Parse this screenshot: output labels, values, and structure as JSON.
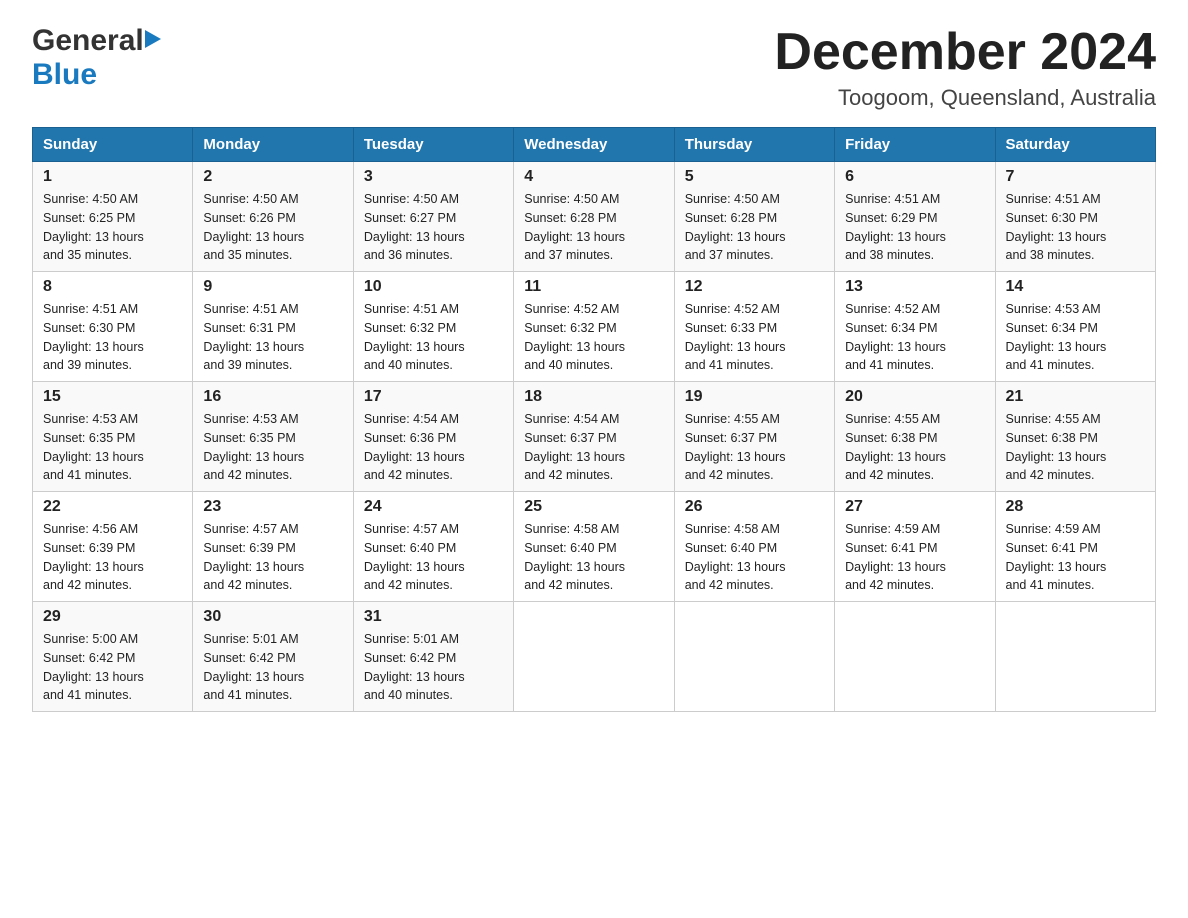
{
  "logo": {
    "general": "General",
    "blue": "Blue"
  },
  "header": {
    "title": "December 2024",
    "subtitle": "Toogoom, Queensland, Australia"
  },
  "days_of_week": [
    "Sunday",
    "Monday",
    "Tuesday",
    "Wednesday",
    "Thursday",
    "Friday",
    "Saturday"
  ],
  "weeks": [
    [
      {
        "day": "1",
        "sunrise": "4:50 AM",
        "sunset": "6:25 PM",
        "daylight": "13 hours and 35 minutes."
      },
      {
        "day": "2",
        "sunrise": "4:50 AM",
        "sunset": "6:26 PM",
        "daylight": "13 hours and 35 minutes."
      },
      {
        "day": "3",
        "sunrise": "4:50 AM",
        "sunset": "6:27 PM",
        "daylight": "13 hours and 36 minutes."
      },
      {
        "day": "4",
        "sunrise": "4:50 AM",
        "sunset": "6:28 PM",
        "daylight": "13 hours and 37 minutes."
      },
      {
        "day": "5",
        "sunrise": "4:50 AM",
        "sunset": "6:28 PM",
        "daylight": "13 hours and 37 minutes."
      },
      {
        "day": "6",
        "sunrise": "4:51 AM",
        "sunset": "6:29 PM",
        "daylight": "13 hours and 38 minutes."
      },
      {
        "day": "7",
        "sunrise": "4:51 AM",
        "sunset": "6:30 PM",
        "daylight": "13 hours and 38 minutes."
      }
    ],
    [
      {
        "day": "8",
        "sunrise": "4:51 AM",
        "sunset": "6:30 PM",
        "daylight": "13 hours and 39 minutes."
      },
      {
        "day": "9",
        "sunrise": "4:51 AM",
        "sunset": "6:31 PM",
        "daylight": "13 hours and 39 minutes."
      },
      {
        "day": "10",
        "sunrise": "4:51 AM",
        "sunset": "6:32 PM",
        "daylight": "13 hours and 40 minutes."
      },
      {
        "day": "11",
        "sunrise": "4:52 AM",
        "sunset": "6:32 PM",
        "daylight": "13 hours and 40 minutes."
      },
      {
        "day": "12",
        "sunrise": "4:52 AM",
        "sunset": "6:33 PM",
        "daylight": "13 hours and 41 minutes."
      },
      {
        "day": "13",
        "sunrise": "4:52 AM",
        "sunset": "6:34 PM",
        "daylight": "13 hours and 41 minutes."
      },
      {
        "day": "14",
        "sunrise": "4:53 AM",
        "sunset": "6:34 PM",
        "daylight": "13 hours and 41 minutes."
      }
    ],
    [
      {
        "day": "15",
        "sunrise": "4:53 AM",
        "sunset": "6:35 PM",
        "daylight": "13 hours and 41 minutes."
      },
      {
        "day": "16",
        "sunrise": "4:53 AM",
        "sunset": "6:35 PM",
        "daylight": "13 hours and 42 minutes."
      },
      {
        "day": "17",
        "sunrise": "4:54 AM",
        "sunset": "6:36 PM",
        "daylight": "13 hours and 42 minutes."
      },
      {
        "day": "18",
        "sunrise": "4:54 AM",
        "sunset": "6:37 PM",
        "daylight": "13 hours and 42 minutes."
      },
      {
        "day": "19",
        "sunrise": "4:55 AM",
        "sunset": "6:37 PM",
        "daylight": "13 hours and 42 minutes."
      },
      {
        "day": "20",
        "sunrise": "4:55 AM",
        "sunset": "6:38 PM",
        "daylight": "13 hours and 42 minutes."
      },
      {
        "day": "21",
        "sunrise": "4:55 AM",
        "sunset": "6:38 PM",
        "daylight": "13 hours and 42 minutes."
      }
    ],
    [
      {
        "day": "22",
        "sunrise": "4:56 AM",
        "sunset": "6:39 PM",
        "daylight": "13 hours and 42 minutes."
      },
      {
        "day": "23",
        "sunrise": "4:57 AM",
        "sunset": "6:39 PM",
        "daylight": "13 hours and 42 minutes."
      },
      {
        "day": "24",
        "sunrise": "4:57 AM",
        "sunset": "6:40 PM",
        "daylight": "13 hours and 42 minutes."
      },
      {
        "day": "25",
        "sunrise": "4:58 AM",
        "sunset": "6:40 PM",
        "daylight": "13 hours and 42 minutes."
      },
      {
        "day": "26",
        "sunrise": "4:58 AM",
        "sunset": "6:40 PM",
        "daylight": "13 hours and 42 minutes."
      },
      {
        "day": "27",
        "sunrise": "4:59 AM",
        "sunset": "6:41 PM",
        "daylight": "13 hours and 42 minutes."
      },
      {
        "day": "28",
        "sunrise": "4:59 AM",
        "sunset": "6:41 PM",
        "daylight": "13 hours and 41 minutes."
      }
    ],
    [
      {
        "day": "29",
        "sunrise": "5:00 AM",
        "sunset": "6:42 PM",
        "daylight": "13 hours and 41 minutes."
      },
      {
        "day": "30",
        "sunrise": "5:01 AM",
        "sunset": "6:42 PM",
        "daylight": "13 hours and 41 minutes."
      },
      {
        "day": "31",
        "sunrise": "5:01 AM",
        "sunset": "6:42 PM",
        "daylight": "13 hours and 40 minutes."
      },
      null,
      null,
      null,
      null
    ]
  ],
  "labels": {
    "sunrise": "Sunrise:",
    "sunset": "Sunset:",
    "daylight": "Daylight:"
  }
}
